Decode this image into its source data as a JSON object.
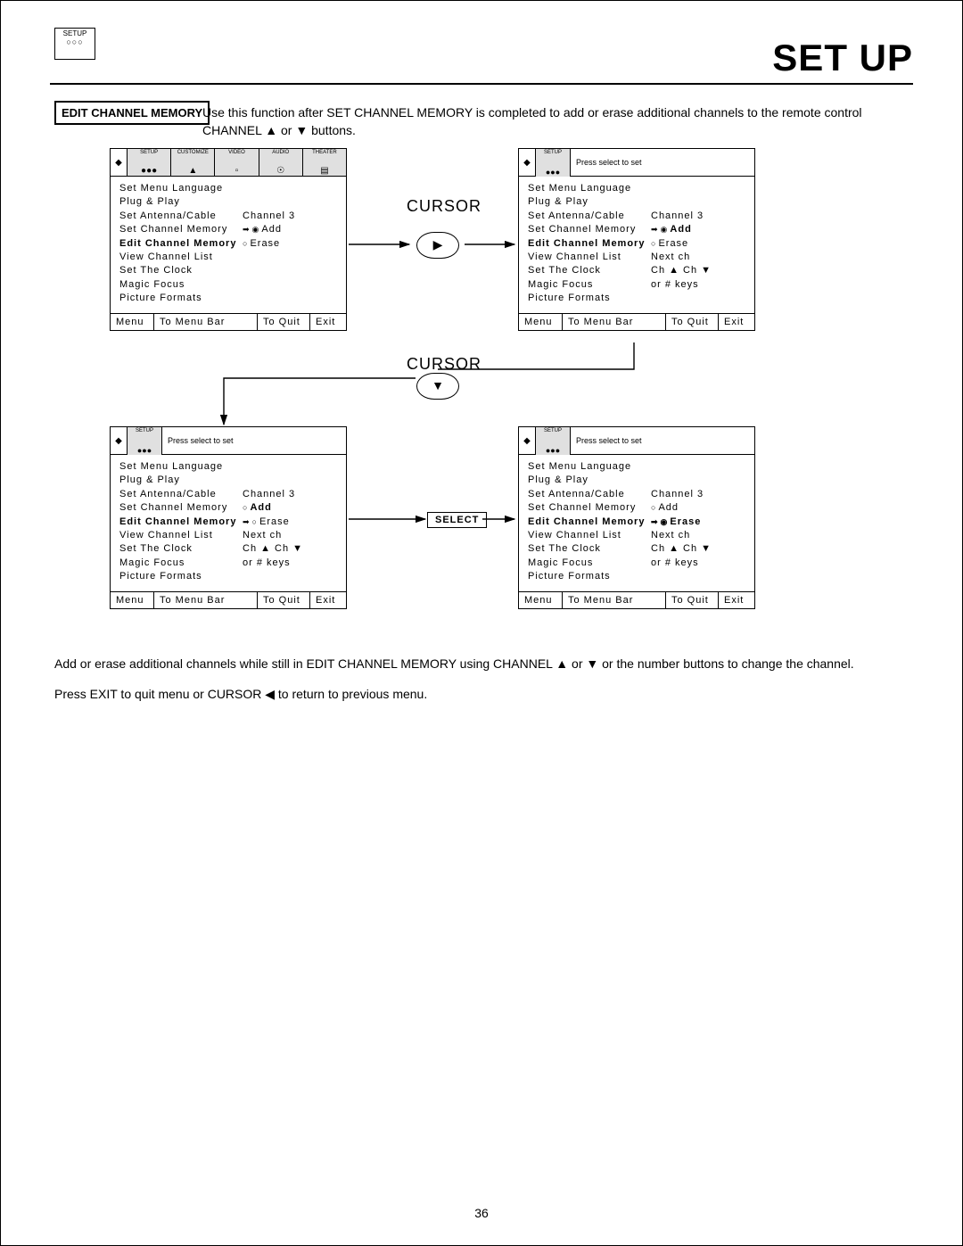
{
  "page_title": "SET UP",
  "setup_icon_label": "SETUP",
  "section_label": "EDIT CHANNEL MEMORY",
  "section_desc": "Use this function after SET CHANNEL MEMORY is completed to add or erase additional channels to the remote control CHANNEL ▲ or ▼ buttons.",
  "header_tabs": {
    "setup": "SETUP",
    "customize": "CUSTOMIZE",
    "video": "VIDEO",
    "audio": "AUDIO",
    "theater": "THEATER"
  },
  "press_select": "Press select to set",
  "menu_items": {
    "set_menu_language": "Set Menu Language",
    "plug_play": "Plug & Play",
    "set_antenna_cable": "Set Antenna/Cable",
    "set_channel_memory": "Set Channel Memory",
    "edit_channel_memory": "Edit Channel Memory",
    "view_channel_list": "View Channel List",
    "set_the_clock": "Set The Clock",
    "magic_focus": "Magic Focus",
    "picture_formats": "Picture Formats"
  },
  "values": {
    "channel3": "Channel 3",
    "add": "Add",
    "erase": "Erase",
    "next_ch": "Next ch",
    "ch_updown": "Ch ▲ Ch ▼",
    "or_num_keys": "or # keys"
  },
  "footer": {
    "menu": "Menu",
    "to_menu_bar": "To Menu Bar",
    "to_quit": "To Quit",
    "exit": "Exit"
  },
  "cursor_label": "CURSOR",
  "select_label": "SELECT",
  "lower_text1": "Add or erase additional channels while still in EDIT CHANNEL MEMORY using CHANNEL ▲ or ▼ or the number buttons to change the channel.",
  "lower_text2": "Press EXIT to quit menu or CURSOR ◀ to return to previous menu.",
  "page_number": "36"
}
